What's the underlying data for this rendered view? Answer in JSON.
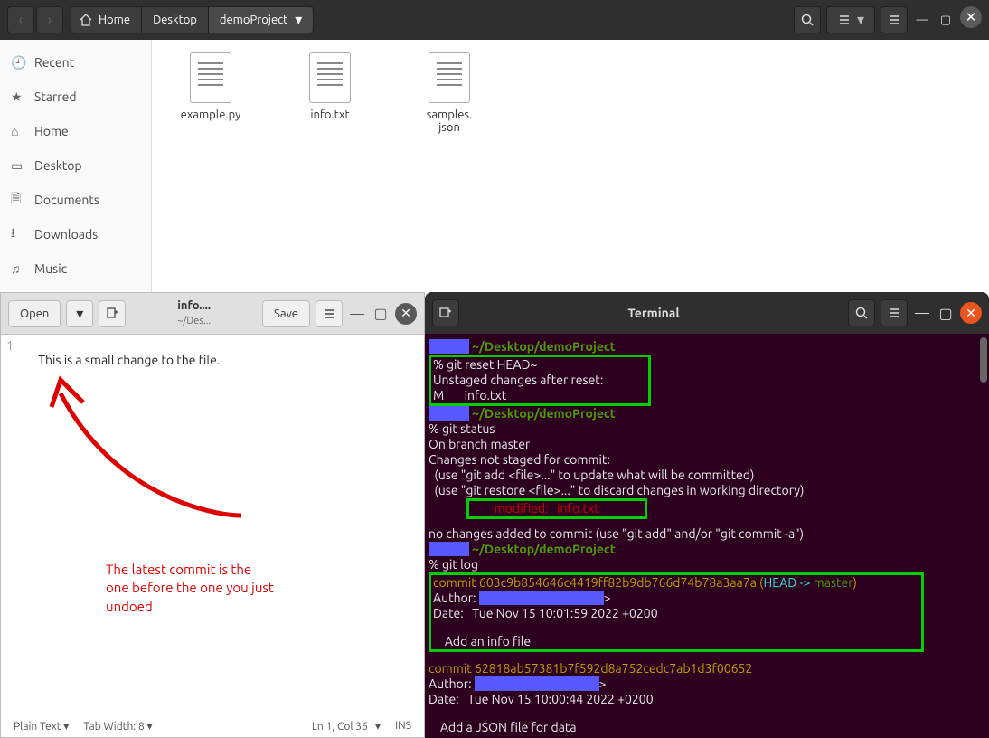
{
  "filemanager": {
    "path": {
      "home": "Home",
      "desktop": "Desktop",
      "project": "demoProject"
    },
    "sidebar": [
      {
        "icon": "clock-icon",
        "label": "Recent"
      },
      {
        "icon": "star-icon",
        "label": "Starred"
      },
      {
        "icon": "home-icon",
        "label": "Home"
      },
      {
        "icon": "desktop-icon",
        "label": "Desktop"
      },
      {
        "icon": "file-icon",
        "label": "Documents"
      },
      {
        "icon": "download-icon",
        "label": "Downloads"
      },
      {
        "icon": "music-icon",
        "label": "Music"
      }
    ],
    "files": [
      {
        "name": "example.py"
      },
      {
        "name": "info.txt"
      },
      {
        "name": "samples.\njson"
      }
    ]
  },
  "gedit": {
    "open": "Open",
    "save": "Save",
    "title": "info....",
    "subtitle": "~/Des...",
    "gutter_line": "1",
    "content": "This is a small change to the file.",
    "status": {
      "lang": "Plain Text",
      "tab": "Tab Width: 8",
      "pos": "Ln 1, Col 36",
      "ins": "INS"
    }
  },
  "annotation": {
    "text": "The latest commit is the\none before the one you just\nundoed"
  },
  "terminal": {
    "title": "Terminal",
    "path_prompt": "~/Desktop/demoProject",
    "lines": {
      "reset_cmd": "% git reset HEAD~",
      "reset_out1": "Unstaged changes after reset:",
      "reset_out2": "M       info.txt",
      "status_cmd": "% git status",
      "status_branch": "On branch master",
      "status_hdr": "Changes not staged for commit:",
      "status_hint1": "  (use \"git add <file>...\" to update what will be committed)",
      "status_hint2": "  (use \"git restore <file>...\" to discard changes in working directory)",
      "status_mod": "        modified:   info.txt",
      "status_foot": "no changes added to commit (use \"git add\" and/or \"git commit -a\")",
      "log_cmd": "% git log",
      "c1_hash": "commit 603c9b854646c4419ff82b9db766d74b78a3aa7a",
      "c1_ref": " (HEAD -> master)",
      "c1_head_arrow": "HEAD -> ",
      "c1_master": "master",
      "author_label": "Author: ",
      "c1_date": "Date:   Tue Nov 15 10:01:59 2022 +0200",
      "c1_msg": "    Add an info file",
      "c2_hash": "commit 62818ab57381b7f592d8a752cedc7ab1d3f00652",
      "c2_date": "Date:   Tue Nov 15 10:00:44 2022 +0200",
      "c2_msg": "    Add a JSON file for data"
    }
  }
}
